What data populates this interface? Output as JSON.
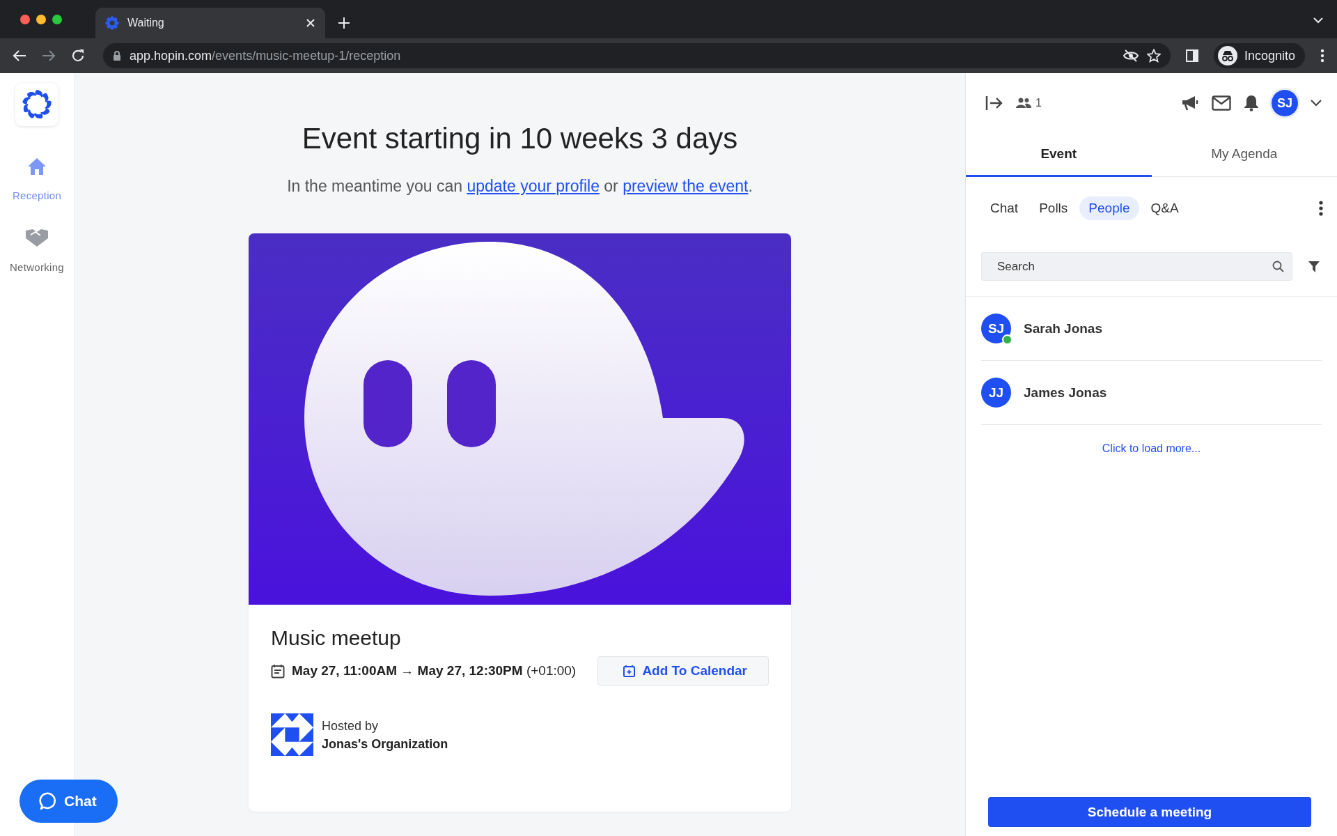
{
  "browser": {
    "tab_title": "Waiting",
    "url_host": "app.hopin.com",
    "url_path": "/events/music-meetup-1/reception",
    "profile": "Incognito"
  },
  "nav": [
    {
      "label": "Reception",
      "selected": true
    },
    {
      "label": "Networking",
      "selected": false
    }
  ],
  "main": {
    "heading": "Event starting in 10 weeks 3 days",
    "intro_before": "In the meantime you can",
    "profile_link": "update your profile",
    "intro_middle": "or",
    "preview_link": "preview the event",
    "intro_after": "."
  },
  "event": {
    "title": "Music meetup",
    "time": "**May 27, 11:00AM → May 27, 12:30PM** (+01:00)",
    "calendar_button": "Add To Calendar",
    "hosted_label": "Hosted by",
    "host": "Jonas's Organization"
  },
  "chat_button": "Chat",
  "panel": {
    "attendee_count": "1",
    "avatar": "SJ",
    "tabs": [
      {
        "label": "Event",
        "selected": true
      },
      {
        "label": "My Agenda",
        "selected": false
      }
    ],
    "subtabs": [
      {
        "label": "Chat",
        "selected": false
      },
      {
        "label": "Polls",
        "selected": false
      },
      {
        "label": "People",
        "selected": true
      },
      {
        "label": "Q&A",
        "selected": false
      }
    ],
    "search": {
      "placeholder": "Search"
    },
    "people": [
      {
        "initials": "SJ",
        "name": "Sarah Jonas",
        "online": true
      },
      {
        "initials": "JJ",
        "name": "James Jonas",
        "online": false
      }
    ],
    "load_more": "Click to load more...",
    "schedule_button": "Schedule a meeting"
  }
}
